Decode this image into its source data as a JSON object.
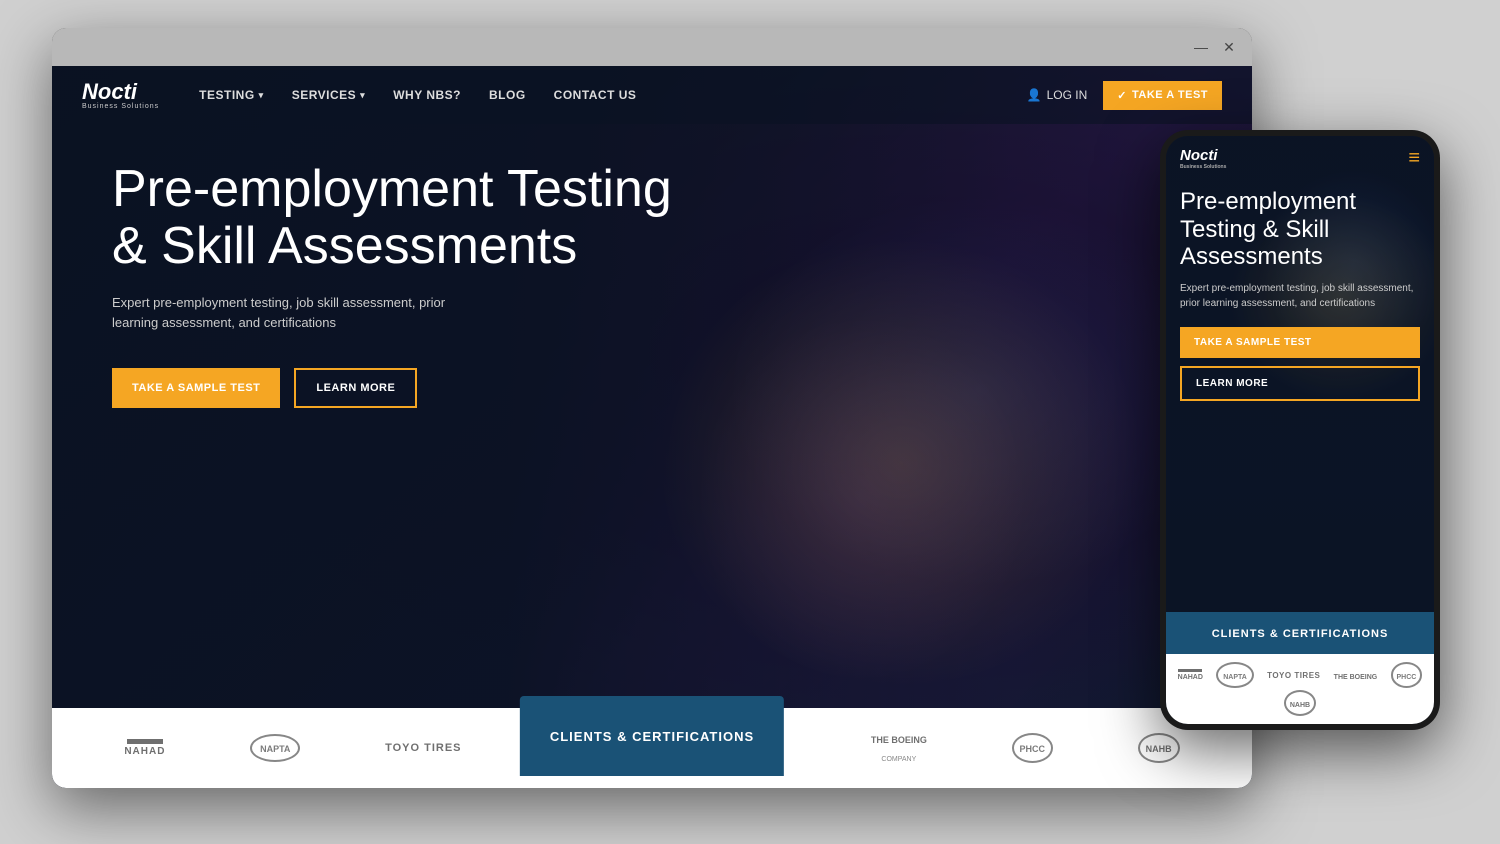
{
  "desktop": {
    "titlebar": {
      "minimize_label": "—",
      "close_label": "✕"
    },
    "navbar": {
      "logo": "Nocti",
      "logo_sub": "Business Solutions",
      "nav_items": [
        {
          "label": "TESTING",
          "has_dropdown": true
        },
        {
          "label": "SERVICES",
          "has_dropdown": true
        },
        {
          "label": "WHY NBS?",
          "has_dropdown": false
        },
        {
          "label": "BLOG",
          "has_dropdown": false
        },
        {
          "label": "CONTACT US",
          "has_dropdown": false
        }
      ],
      "login_label": "LOG IN",
      "take_test_label": "TAKE A TEST"
    },
    "hero": {
      "title": "Pre-employment Testing & Skill Assessments",
      "subtitle": "Expert pre-employment testing, job skill assessment, prior learning assessment, and certifications",
      "btn_sample": "TAKE A SAMPLE TEST",
      "btn_learn": "LEARN MORE"
    },
    "clients_bar": {
      "tab_label": "CLIENTS & CERTIFICATIONS",
      "logos": [
        "NAHAD",
        "NAPTA",
        "TOYO TIRES",
        "THE BOEING COMPANY",
        "PHCC",
        "NAHB"
      ]
    }
  },
  "mobile": {
    "navbar": {
      "logo": "Nocti",
      "logo_sub": "Business Solutions",
      "menu_icon": "≡"
    },
    "hero": {
      "title": "Pre-employment Testing & Skill Assessments",
      "subtitle": "Expert pre-employment testing, job skill assessment, prior learning assessment, and certifications",
      "btn_sample": "TAKE A SAMPLE TEST",
      "btn_learn": "LEARN MORE"
    },
    "clients_section": {
      "tab_label": "CLIENTS & CERTIFICATIONS",
      "logos": [
        "NAHAD",
        "NAPTA",
        "TOYO TIRES",
        "THE BOEING",
        "PHCC",
        "NAHB"
      ]
    }
  },
  "colors": {
    "accent": "#f5a623",
    "dark_bg": "#0f1b2d",
    "teal_tab": "#1a5276",
    "white": "#ffffff"
  }
}
